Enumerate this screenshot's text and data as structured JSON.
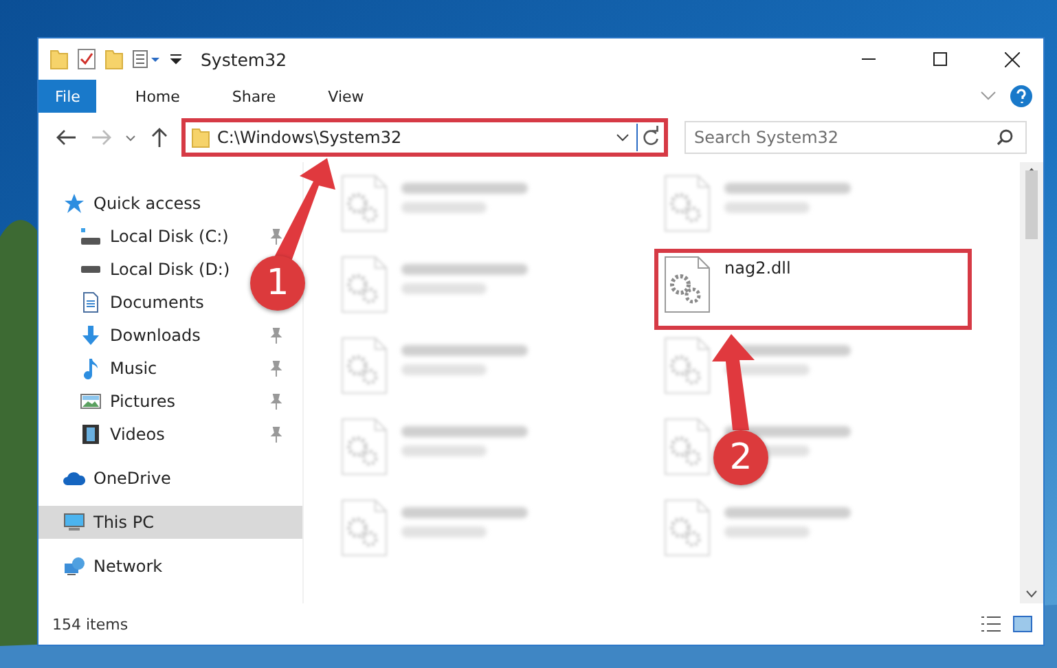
{
  "window": {
    "title": "System32"
  },
  "ribbon_tabs": [
    {
      "label": "File",
      "kind": "file"
    },
    {
      "label": "Home",
      "kind": "tab"
    },
    {
      "label": "Share",
      "kind": "tab"
    },
    {
      "label": "View",
      "kind": "tab"
    }
  ],
  "address": {
    "path": "C:\\Windows\\System32",
    "highlighted": true
  },
  "search": {
    "placeholder": "Search System32"
  },
  "sidebar": {
    "items": [
      {
        "label": "Quick access",
        "kind": "star",
        "selected": false,
        "children": [
          {
            "label": "Local Disk (C:)",
            "kind": "drive-c",
            "pinned": true
          },
          {
            "label": "Local Disk (D:)",
            "kind": "drive"
          },
          {
            "label": "Documents",
            "kind": "documents"
          },
          {
            "label": "Downloads",
            "kind": "downloads",
            "pinned": true
          },
          {
            "label": "Music",
            "kind": "music",
            "pinned": true
          },
          {
            "label": "Pictures",
            "kind": "pictures",
            "pinned": true
          },
          {
            "label": "Videos",
            "kind": "videos",
            "pinned": true
          }
        ]
      },
      {
        "label": "OneDrive",
        "kind": "cloud",
        "selected": false
      },
      {
        "label": "This PC",
        "kind": "pc",
        "selected": true
      },
      {
        "label": "Network",
        "kind": "network",
        "selected": false
      }
    ]
  },
  "files": [
    {
      "kind": "blurred",
      "highlighted": false
    },
    {
      "kind": "blurred",
      "highlighted": false
    },
    {
      "kind": "blurred",
      "highlighted": false
    },
    {
      "kind": "file",
      "name": "nag2.dll",
      "highlighted": true
    },
    {
      "kind": "blurred",
      "highlighted": false
    },
    {
      "kind": "blurred",
      "highlighted": false
    },
    {
      "kind": "blurred",
      "highlighted": false
    },
    {
      "kind": "blurred",
      "highlighted": false
    },
    {
      "kind": "blurred",
      "highlighted": false
    },
    {
      "kind": "blurred",
      "highlighted": false
    }
  ],
  "status_bar": {
    "count": "154 items"
  },
  "annotations": [
    {
      "label": "1"
    },
    {
      "label": "2"
    }
  ]
}
